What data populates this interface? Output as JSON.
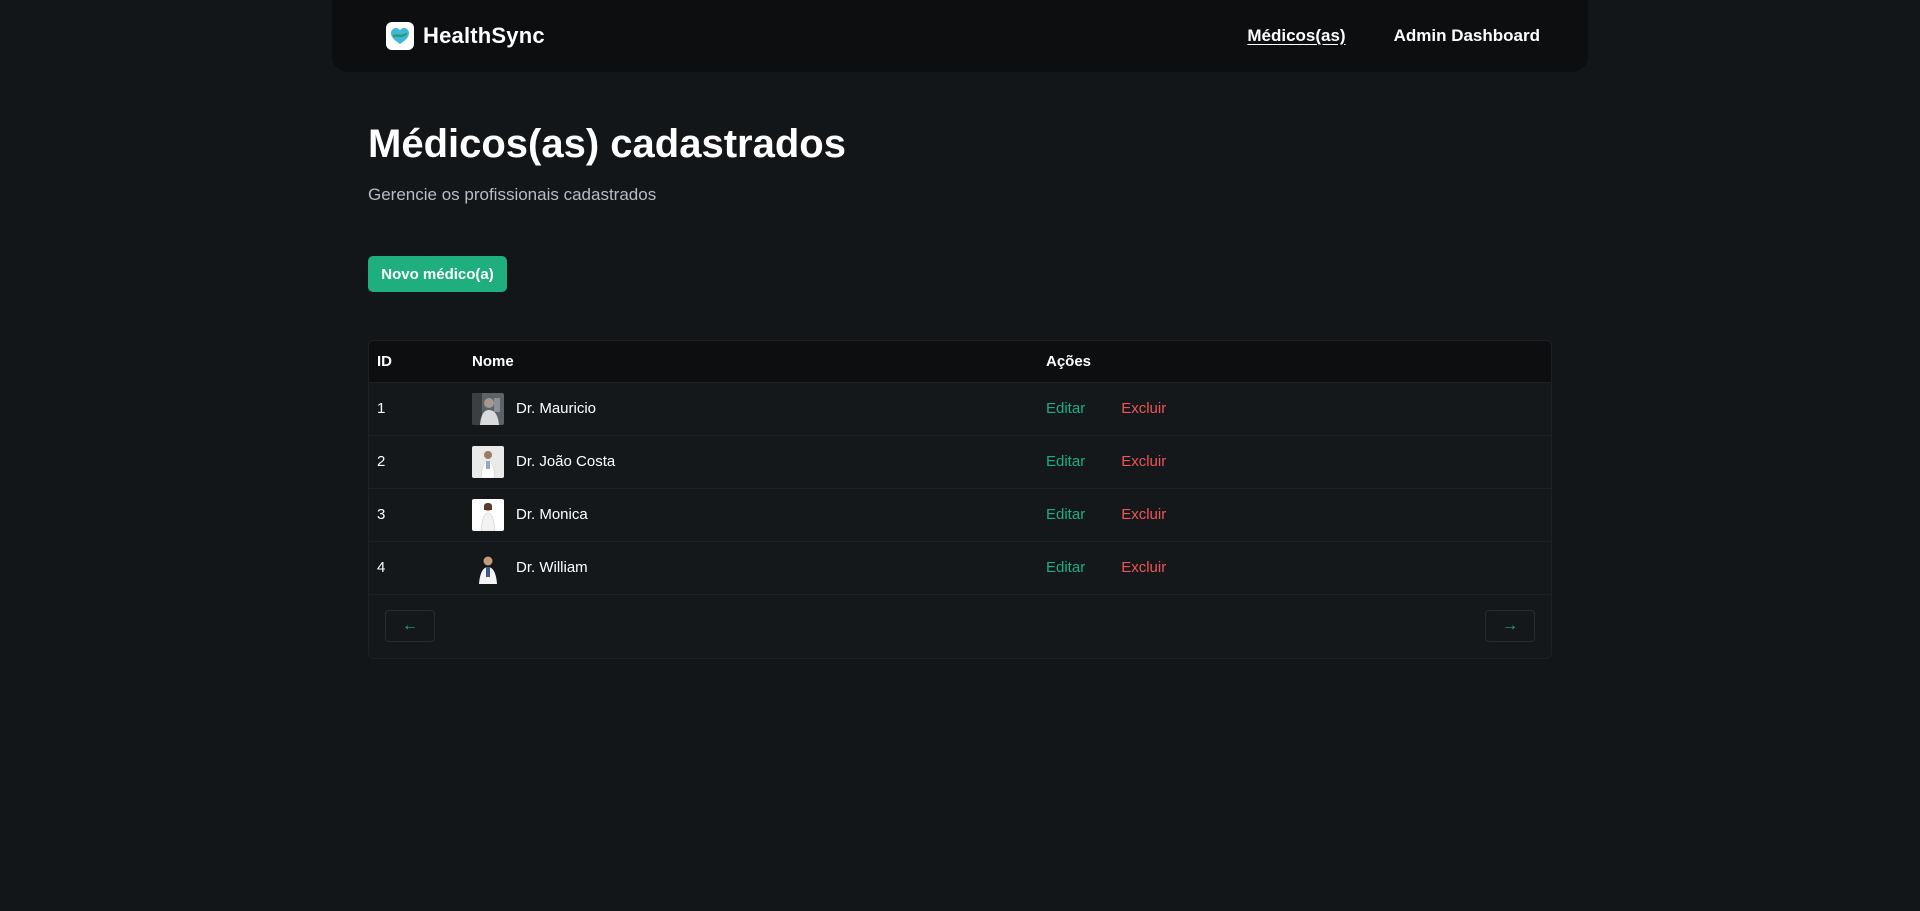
{
  "nav": {
    "brand": "HealthSync",
    "links": [
      {
        "label": "Médicos(as)",
        "active": true
      },
      {
        "label": "Admin Dashboard",
        "active": false
      }
    ]
  },
  "page": {
    "title": "Médicos(as) cadastrados",
    "subtitle": "Gerencie os profissionais cadastrados",
    "new_button": "Novo médico(a)"
  },
  "table": {
    "headers": {
      "id": "ID",
      "name": "Nome",
      "actions": "Ações"
    },
    "rows": [
      {
        "id": "1",
        "name": "Dr. Mauricio",
        "edit": "Editar",
        "delete": "Excluir"
      },
      {
        "id": "2",
        "name": "Dr. João Costa",
        "edit": "Editar",
        "delete": "Excluir"
      },
      {
        "id": "3",
        "name": "Dr. Monica",
        "edit": "Editar",
        "delete": "Excluir"
      },
      {
        "id": "4",
        "name": "Dr. William",
        "edit": "Editar",
        "delete": "Excluir"
      }
    ]
  },
  "pagination": {
    "prev_icon": "arrow-left-icon",
    "next_icon": "arrow-right-icon"
  },
  "colors": {
    "background": "#121619",
    "navbar": "#0c0e10",
    "accent": "#1fae7d",
    "danger": "#f05454"
  }
}
